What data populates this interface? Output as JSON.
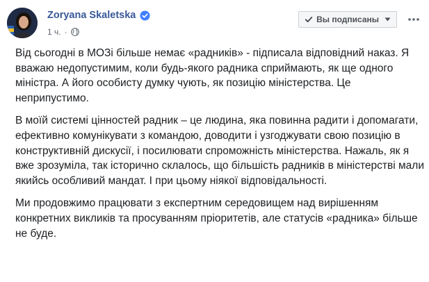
{
  "post": {
    "author": "Zoryana Skaletska",
    "timestamp": "1 ч.",
    "separator": "·",
    "subscribe_label": "Вы подписаны",
    "paragraphs": [
      "Від сьогодні в МОЗі більше немає «радників» - підписала відповідний наказ. Я вважаю недопустимим, коли будь-якого радника сприймають, як ще одного міністра. А його особисту думку чують, як позицію міністерства. Це неприпустимо.",
      "В моїй системі цінностей радник – це людина, яка повинна радити і допомагати, ефективно комунікувати з командою, доводити і узгоджувати свою позицію в конструктивній дискусії, і посилювати спроможність міністерства. Нажаль, як я вже зрозуміла, так історично склалось, що більшість радників в міністерстві мали якийсь особливий мандат. І при цьому ніякої відповідальності.",
      "Ми продовжимо працювати з експертним середовищем над вирішенням конкретних викликів та просуванням пріоритетів, але статусів «радника» більше не буде."
    ]
  },
  "icons": {
    "verified": "verified-badge-icon",
    "audience": "globe-icon",
    "check": "check-icon",
    "caret": "caret-down-icon",
    "more": "more-options-icon"
  },
  "colors": {
    "author_link": "#385898",
    "verified": "#4080ff",
    "meta_text": "#616770",
    "button_bg": "#f5f6f7",
    "body_text": "#1c1e21"
  }
}
